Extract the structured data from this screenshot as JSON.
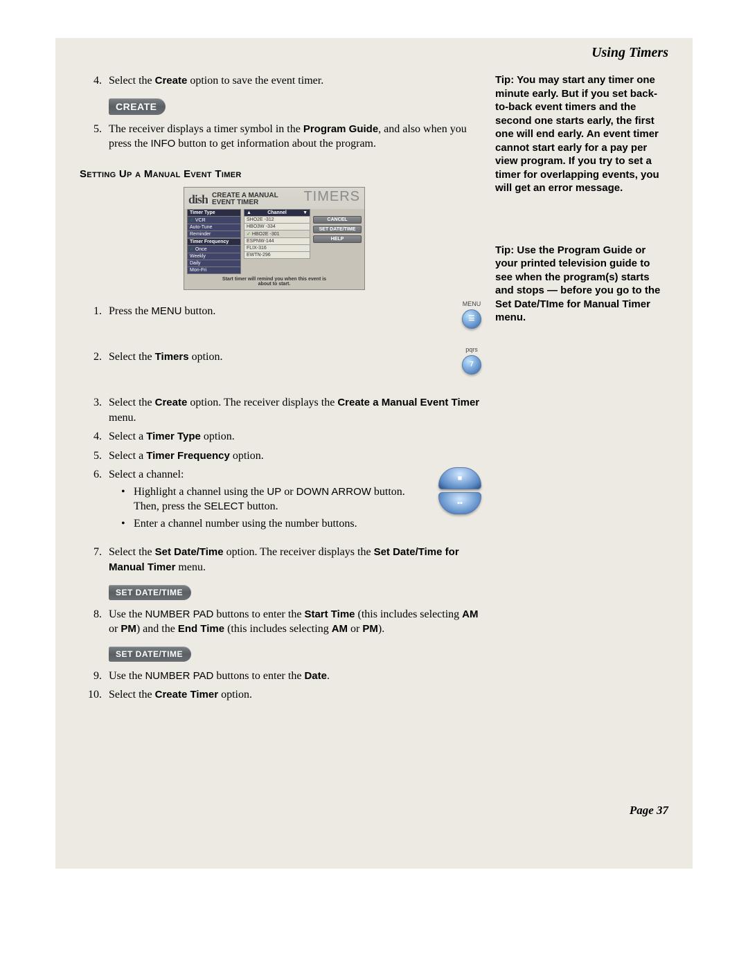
{
  "header": {
    "title": "Using Timers"
  },
  "main": {
    "step4_pre": "Select the ",
    "step4_bold": "Create",
    "step4_post": " option to save the event timer.",
    "create_btn": "CREATE",
    "step5_a": "The receiver displays a timer symbol in the ",
    "step5_b": "Program Guide",
    "step5_c": ", and also when you press the ",
    "step5_d": "INFO",
    "step5_e": " button to get information about the program.",
    "section_title": "Setting Up a Manual Event Timer",
    "embed": {
      "logo": "dish",
      "title1": "CREATE A MANUAL",
      "title2": "EVENT TIMER",
      "bgword": "TIMERS",
      "left_hdr1": "Timer Type",
      "left_r1": "VCR",
      "left_r2": "Auto-Tune",
      "left_r3": "Reminder",
      "left_hdr2": "Timer Frequency",
      "left_r4": "Once",
      "left_r5": "Weekly",
      "left_r6": "Daily",
      "left_r7": "Mon-Fri",
      "mid_hdr_a": "▲",
      "mid_hdr_b": "Channel",
      "mid_hdr_c": "▼",
      "mid_r1": "SHO2E -312",
      "mid_r2": "HBO3W -334",
      "mid_r3": "HBO2E -301",
      "mid_r4": "ESPNW-144",
      "mid_r5": "FLIX-316",
      "mid_r6": "EWTN-296",
      "btn_cancel": "CANCEL",
      "btn_setdate": "SET DATE/TIME",
      "btn_help": "HELP",
      "footer1": "Start timer will remind you when this event is",
      "footer2": "about to start."
    },
    "remote_menu_label": "MENU",
    "remote_pqrs_label": "pqrs",
    "remote_pqrs_num": "7",
    "s1_a": "Press the ",
    "s1_b": "MENU",
    "s1_c": " button.",
    "s2_a": "Select the ",
    "s2_b": "Timers",
    "s2_c": " option.",
    "s3_a": "Select the ",
    "s3_b": "Create",
    "s3_c": " option. The receiver displays the ",
    "s3_d": "Create a Manual Event Timer",
    "s3_e": " menu.",
    "s4_a": "Select a ",
    "s4_b": "Timer Type",
    "s4_c": " option.",
    "s5_a": "Select a ",
    "s5_b": "Timer Frequency",
    "s5_c": " option.",
    "s6": "Select a channel:",
    "s6_sub1_a": "Highlight a channel using the ",
    "s6_sub1_b": "UP",
    "s6_sub1_c": " or ",
    "s6_sub1_d": "DOWN ARROW",
    "s6_sub1_e": " button. Then, press the ",
    "s6_sub1_f": "SELECT",
    "s6_sub1_g": " button.",
    "s6_sub2": "Enter a channel number using the number buttons.",
    "s7_a": "Select the ",
    "s7_b": "Set Date/Time",
    "s7_c": " option. The receiver displays the ",
    "s7_d": "Set Date/Time for Manual Timer",
    "s7_e": " menu.",
    "setdate_btn": "SET DATE/TIME",
    "s8_a": "Use the ",
    "s8_b": "NUMBER PAD",
    "s8_c": " buttons to enter the ",
    "s8_d": "Start Time",
    "s8_e": " (this includes selecting ",
    "s8_f": "AM",
    "s8_g": " or ",
    "s8_h": "PM",
    "s8_i": ") and the ",
    "s8_j": "End Time",
    "s8_k": " (this includes selecting ",
    "s8_l": "AM",
    "s8_m": " or ",
    "s8_n": "PM",
    "s8_o": ").",
    "s9_a": "Use the ",
    "s9_b": "NUMBER PAD",
    "s9_c": " buttons to enter the ",
    "s9_d": "Date",
    "s9_e": ".",
    "s10_a": "Select the ",
    "s10_b": "Create Timer",
    "s10_c": " option."
  },
  "tips": {
    "tip1": "Tip: You may start any timer one minute early. But if you set back-to-back event timers and the second one starts early, the first one will end early. An event timer cannot start early for a pay per view program. If you try to set a timer for overlapping events, you will get an error message.",
    "tip2": "Tip: Use the Program Guide or your printed television guide to see when the program(s) starts and stops — before you go to the Set Date/TIme for Manual Timer menu."
  },
  "footer": {
    "page": "Page 37"
  }
}
